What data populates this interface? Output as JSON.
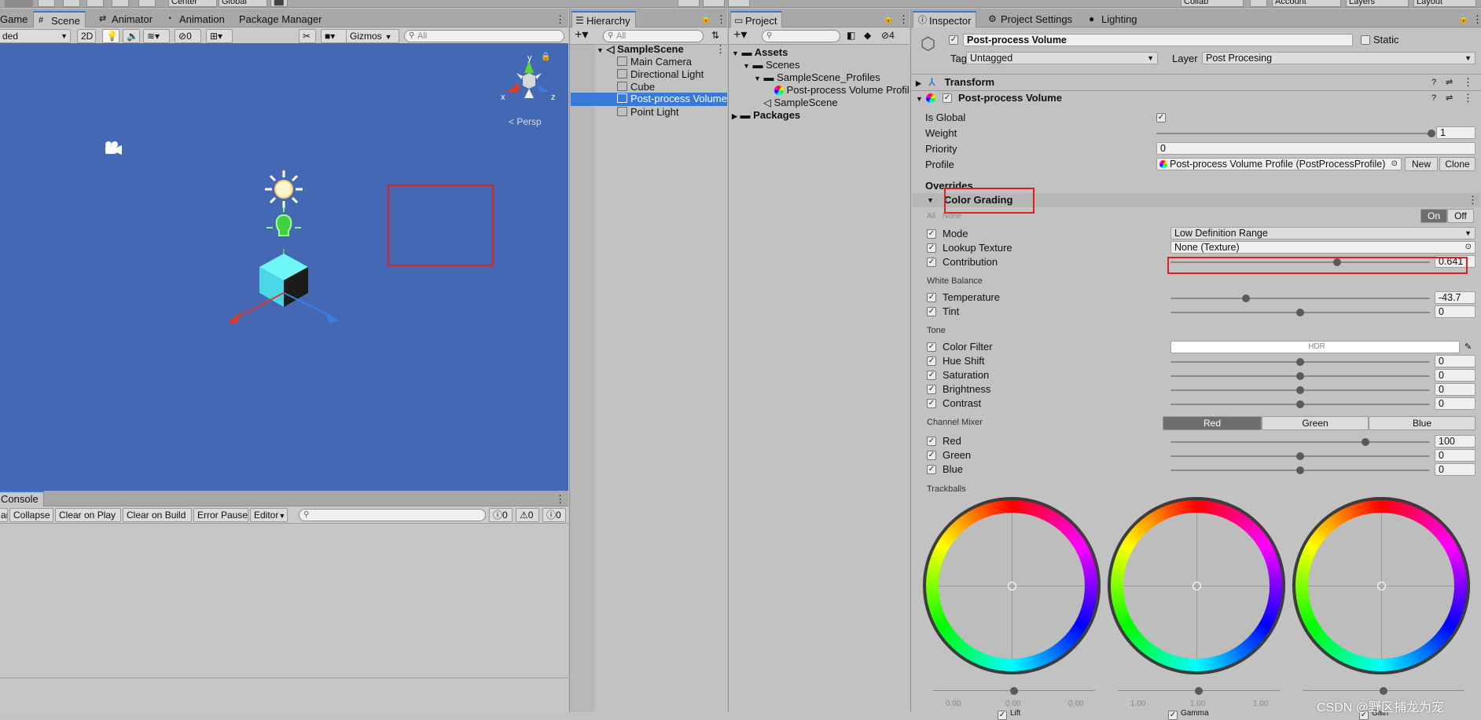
{
  "top_toolbar": {
    "center": "Center",
    "global": "Global",
    "collab": "Collab",
    "account": "Account",
    "layers": "Layers",
    "layout": "Layout"
  },
  "scene_panel": {
    "tabs": [
      "Game",
      "Scene",
      "Animator",
      "Animation",
      "Package Manager"
    ],
    "shading_mode": "ded",
    "mode_2d": "2D",
    "hidden_count": "0",
    "gizmos": "Gizmos",
    "search_placeholder": "All",
    "gizmo_axes": {
      "x": "x",
      "y": "y",
      "z": "z"
    },
    "persp": "< Persp"
  },
  "console_panel": {
    "tab": "Console",
    "buttons": [
      "ar",
      "Collapse",
      "Clear on Play",
      "Clear on Build",
      "Error Pause",
      "Editor"
    ],
    "counts": [
      "0",
      "0",
      "0"
    ]
  },
  "hierarchy": {
    "tab": "Hierarchy",
    "search_placeholder": "All",
    "scene": "SampleScene",
    "items": [
      "Main Camera",
      "Directional Light",
      "Cube",
      "Post-process Volume",
      "Point Light"
    ]
  },
  "project": {
    "tab": "Project",
    "hidden_count": "4",
    "tree": [
      "Assets",
      "Scenes",
      "SampleScene_Profiles",
      "Post-process Volume Profil",
      "SampleScene",
      "Packages"
    ]
  },
  "inspector": {
    "tabs": [
      "Inspector",
      "Project Settings",
      "Lighting"
    ],
    "object_name": "Post-process Volume",
    "static_label": "Static",
    "tag_label": "Tag",
    "tag_value": "Untagged",
    "layer_label": "Layer",
    "layer_value": "Post Procesing",
    "transform": "Transform",
    "component": "Post-process Volume",
    "is_global": "Is Global",
    "weight": {
      "label": "Weight",
      "value": "1",
      "fraction": 1.0
    },
    "priority": {
      "label": "Priority",
      "value": "0"
    },
    "profile": {
      "label": "Profile",
      "value": "Post-process Volume Profile (PostProcessProfile)",
      "new": "New",
      "clone": "Clone"
    },
    "overrides": "Overrides",
    "effect": "Color Grading",
    "all_none": [
      "All",
      "None"
    ],
    "on_off": [
      "On",
      "Off"
    ],
    "mode": {
      "label": "Mode",
      "value": "Low Definition Range"
    },
    "lookup": {
      "label": "Lookup Texture",
      "value": "None (Texture)"
    },
    "contribution": {
      "label": "Contribution",
      "value": "0.641",
      "fraction": 0.641
    },
    "white_balance": "White Balance",
    "temperature": {
      "label": "Temperature",
      "value": "-43.7",
      "fraction": 0.29
    },
    "tint": {
      "label": "Tint",
      "value": "0",
      "fraction": 0.5
    },
    "tone": "Tone",
    "color_filter": {
      "label": "Color Filter",
      "value": "HDR"
    },
    "hue_shift": {
      "label": "Hue Shift",
      "value": "0",
      "fraction": 0.5
    },
    "saturation": {
      "label": "Saturation",
      "value": "0",
      "fraction": 0.5
    },
    "brightness": {
      "label": "Brightness",
      "value": "0",
      "fraction": 0.5
    },
    "contrast": {
      "label": "Contrast",
      "value": "0",
      "fraction": 0.5
    },
    "channel_mixer": "Channel Mixer",
    "channel_tabs": [
      "Red",
      "Green",
      "Blue"
    ],
    "red": {
      "label": "Red",
      "value": "100",
      "fraction": 0.75
    },
    "green": {
      "label": "Green",
      "value": "0",
      "fraction": 0.5
    },
    "blue": {
      "label": "Blue",
      "value": "0",
      "fraction": 0.5
    },
    "trackballs": "Trackballs",
    "wheels": [
      {
        "name": "Lift",
        "values": [
          "0.00",
          "0.00",
          "0.00"
        ]
      },
      {
        "name": "Gamma",
        "values": [
          "1.00",
          "1.00",
          "1.00"
        ]
      },
      {
        "name": "Gain",
        "values": [
          "",
          "",
          ""
        ]
      }
    ]
  },
  "watermark": "CSDN @野区捕龙为宠",
  "colors": {
    "scene_bg": "#4468b3",
    "selection": "#3a79d7",
    "highlight_box": "#e02020"
  }
}
